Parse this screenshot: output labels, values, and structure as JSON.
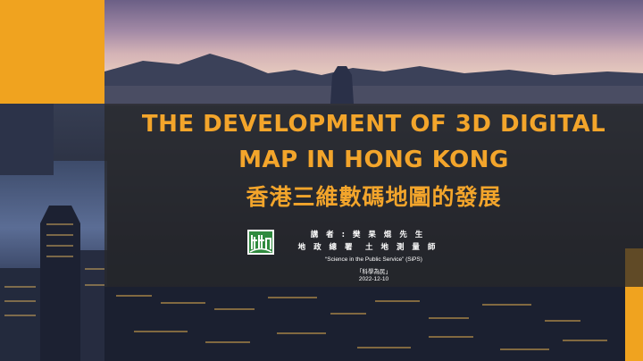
{
  "slide": {
    "title_line1": "THE DEVELOPMENT OF 3D DIGITAL",
    "title_line2": "MAP IN HONG KONG",
    "title_chinese": "香港三維數碼地圖的發展",
    "speaker_line1": "講 者 : 樊 杲 焜 先 生",
    "speaker_line2": "地 政 總 署　土 地 測 量 師",
    "series_name": "“Science in the Public Service” (SiPS)",
    "series_chinese": "「科學為民」",
    "date": "2022-12-10"
  },
  "colors": {
    "accent_orange": "#f0a31f",
    "title_text": "#f3a52b",
    "band": "rgba(40,40,42,0.72)"
  },
  "icons": {
    "logo": "lands-department-logo"
  }
}
